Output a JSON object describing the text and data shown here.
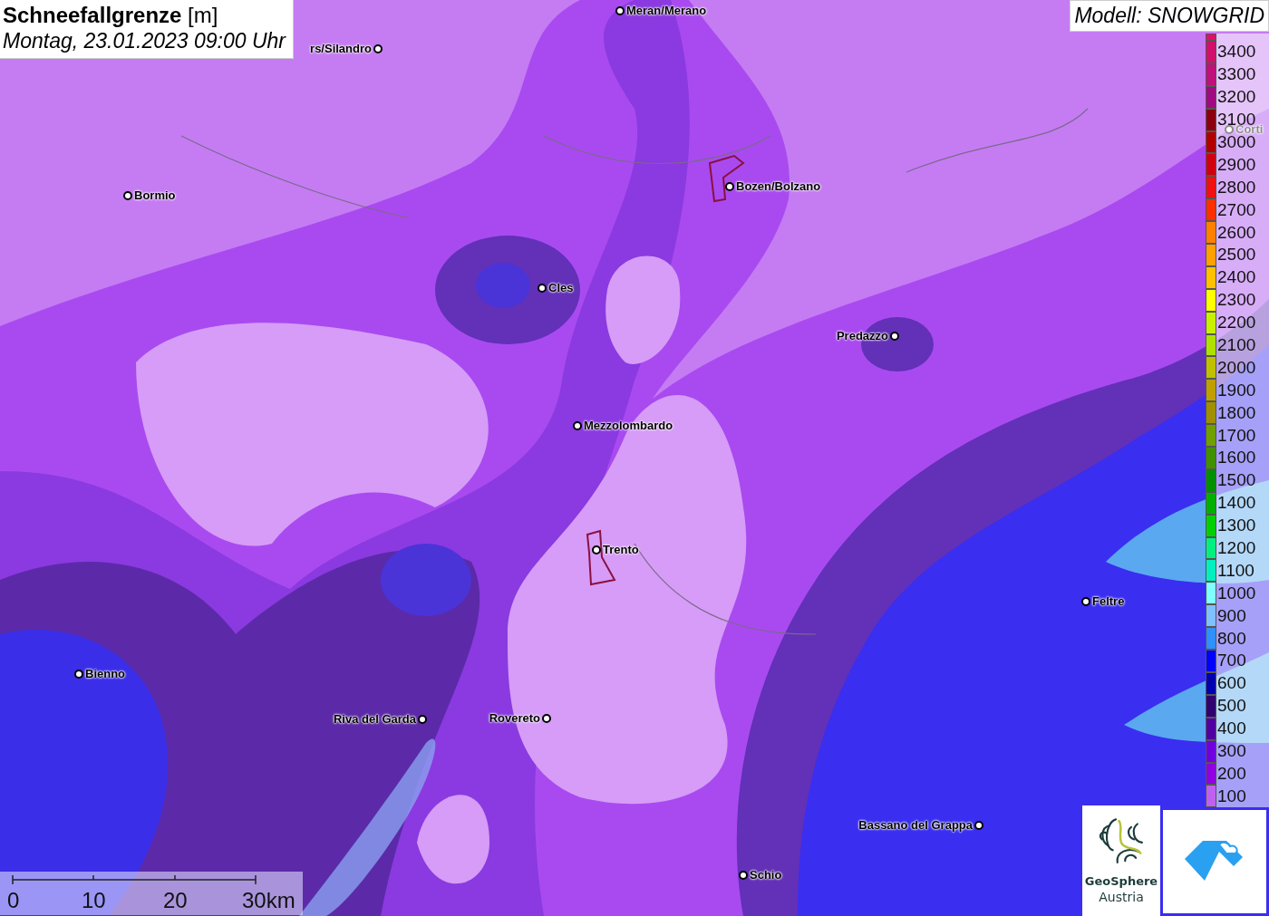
{
  "title": {
    "name": "Schneefallgrenze",
    "unit": "[m]",
    "date": "Montag, 23.01.2023 09:00 Uhr"
  },
  "model": "Modell: SNOWGRID",
  "cities": [
    {
      "name": "Meran/Merano"
    },
    {
      "name": "rs/Silandro"
    },
    {
      "name": "Bormio"
    },
    {
      "name": "Bozen/Bolzano"
    },
    {
      "name": "Cles"
    },
    {
      "name": "Predazzo"
    },
    {
      "name": "Mezzolombardo"
    },
    {
      "name": "Trento"
    },
    {
      "name": "Feltre"
    },
    {
      "name": "Bienno"
    },
    {
      "name": "Riva del Garda"
    },
    {
      "name": "Rovereto"
    },
    {
      "name": "Bassano del Grappa"
    },
    {
      "name": "Schio"
    },
    {
      "name": "Corti"
    }
  ],
  "legend": [
    {
      "label": "3400",
      "color": "#d0106a"
    },
    {
      "label": "3300",
      "color": "#c0107a"
    },
    {
      "label": "3200",
      "color": "#a00a80"
    },
    {
      "label": "3100",
      "color": "#8b0010"
    },
    {
      "label": "3000",
      "color": "#b00000"
    },
    {
      "label": "2900",
      "color": "#d00010"
    },
    {
      "label": "2800",
      "color": "#f01010"
    },
    {
      "label": "2700",
      "color": "#ff3000"
    },
    {
      "label": "2600",
      "color": "#ff8000"
    },
    {
      "label": "2500",
      "color": "#ffa000"
    },
    {
      "label": "2400",
      "color": "#ffc000"
    },
    {
      "label": "2300",
      "color": "#ffff00"
    },
    {
      "label": "2200",
      "color": "#c8f000"
    },
    {
      "label": "2100",
      "color": "#b0e000"
    },
    {
      "label": "2000",
      "color": "#c0c000"
    },
    {
      "label": "1900",
      "color": "#c0a000"
    },
    {
      "label": "1800",
      "color": "#a09000"
    },
    {
      "label": "1700",
      "color": "#70a000"
    },
    {
      "label": "1600",
      "color": "#409000"
    },
    {
      "label": "1500",
      "color": "#009000"
    },
    {
      "label": "1400",
      "color": "#00b000"
    },
    {
      "label": "1300",
      "color": "#00d000"
    },
    {
      "label": "1200",
      "color": "#00f080"
    },
    {
      "label": "1100",
      "color": "#00f0c0"
    },
    {
      "label": "1000",
      "color": "#80ffff"
    },
    {
      "label": "900",
      "color": "#80c0ff"
    },
    {
      "label": "800",
      "color": "#3090ff"
    },
    {
      "label": "700",
      "color": "#0000ff"
    },
    {
      "label": "600",
      "color": "#0000b0"
    },
    {
      "label": "500",
      "color": "#300070"
    },
    {
      "label": "400",
      "color": "#5000a0"
    },
    {
      "label": "300",
      "color": "#7000e0"
    },
    {
      "label": "200",
      "color": "#9000e0"
    },
    {
      "label": "100",
      "color": "#c060f0"
    }
  ],
  "scale": [
    "0",
    "10",
    "20",
    "30km"
  ],
  "logo": {
    "name": "GeoSphere",
    "sub": "Austria"
  }
}
